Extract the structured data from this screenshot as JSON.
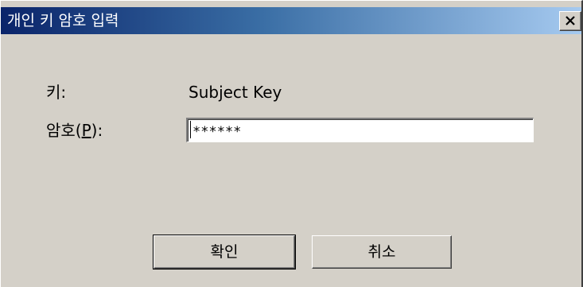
{
  "window": {
    "title": "개인 키 암호 입력"
  },
  "fields": {
    "key_label": "키:",
    "key_value": "Subject Key",
    "password_label_prefix": "암호(",
    "password_label_mnemonic": "P",
    "password_label_suffix": "):",
    "password_value": "******"
  },
  "buttons": {
    "ok_label": "확인",
    "cancel_label": "취소"
  },
  "icons": {
    "close": "close-icon"
  },
  "colors": {
    "title_bar_start": "#0a246a",
    "title_bar_end": "#a6caf0",
    "dialog_background": "#d4d0c8"
  }
}
